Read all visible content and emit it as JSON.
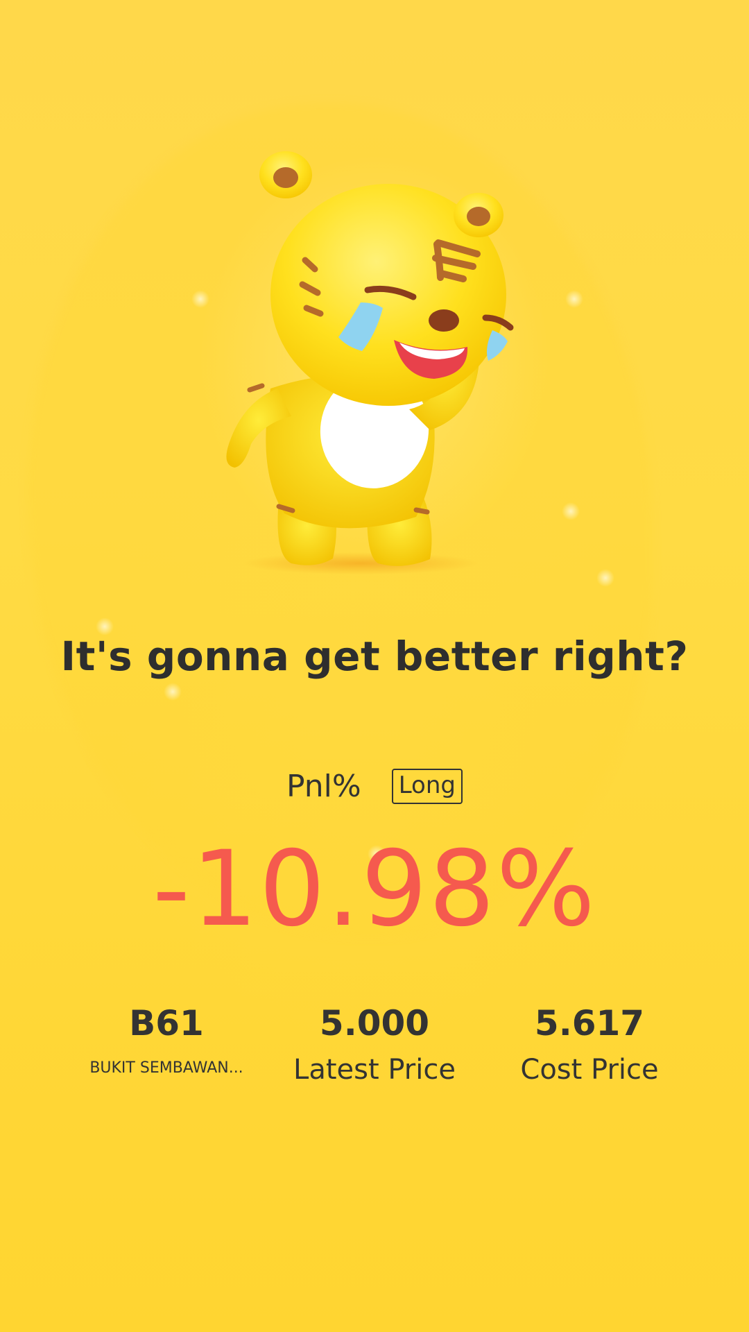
{
  "headline": "It's gonna get better right?",
  "pnl": {
    "label": "Pnl%",
    "direction": "Long",
    "value": "-10.98%",
    "value_color": "#f55a4e"
  },
  "stats": {
    "symbol": {
      "value": "B61",
      "label": "BUKIT SEMBAWAN..."
    },
    "latest_price": {
      "value": "5.000",
      "label": "Latest Price"
    },
    "cost_price": {
      "value": "5.617",
      "label": "Cost Price"
    }
  },
  "mascot": {
    "icon": "crying-tiger-mascot-icon"
  },
  "colors": {
    "background": "#ffd93a",
    "text": "#333333",
    "loss": "#f55a4e"
  }
}
